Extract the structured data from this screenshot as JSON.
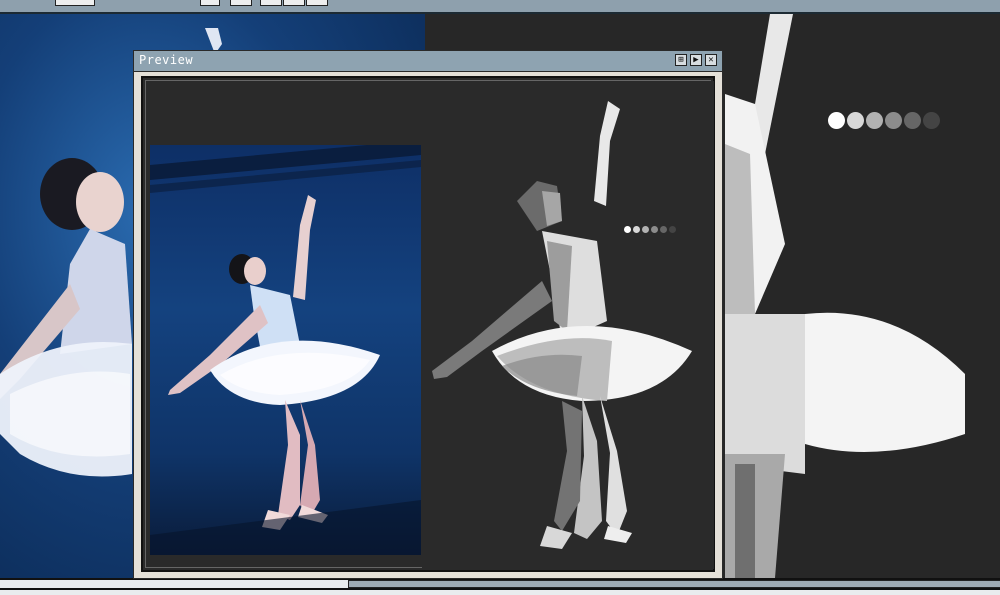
{
  "window": {
    "title": "Preview",
    "buttons": [
      {
        "name": "zoom-button",
        "glyph": "⊞"
      },
      {
        "name": "play-button",
        "glyph": "▶"
      },
      {
        "name": "close-button",
        "glyph": "✕"
      }
    ]
  },
  "palette": [
    "#ffffff",
    "#d8d8d8",
    "#b2b2b2",
    "#8c8c8c",
    "#666666",
    "#444444"
  ],
  "colors": {
    "titlebar": "#8ea3b1",
    "canvas_bg": "#2a2a2a",
    "photo_blue": "#14427f"
  },
  "icons": {
    "zoom": "expand-icon",
    "play": "play-icon",
    "close": "close-icon"
  }
}
